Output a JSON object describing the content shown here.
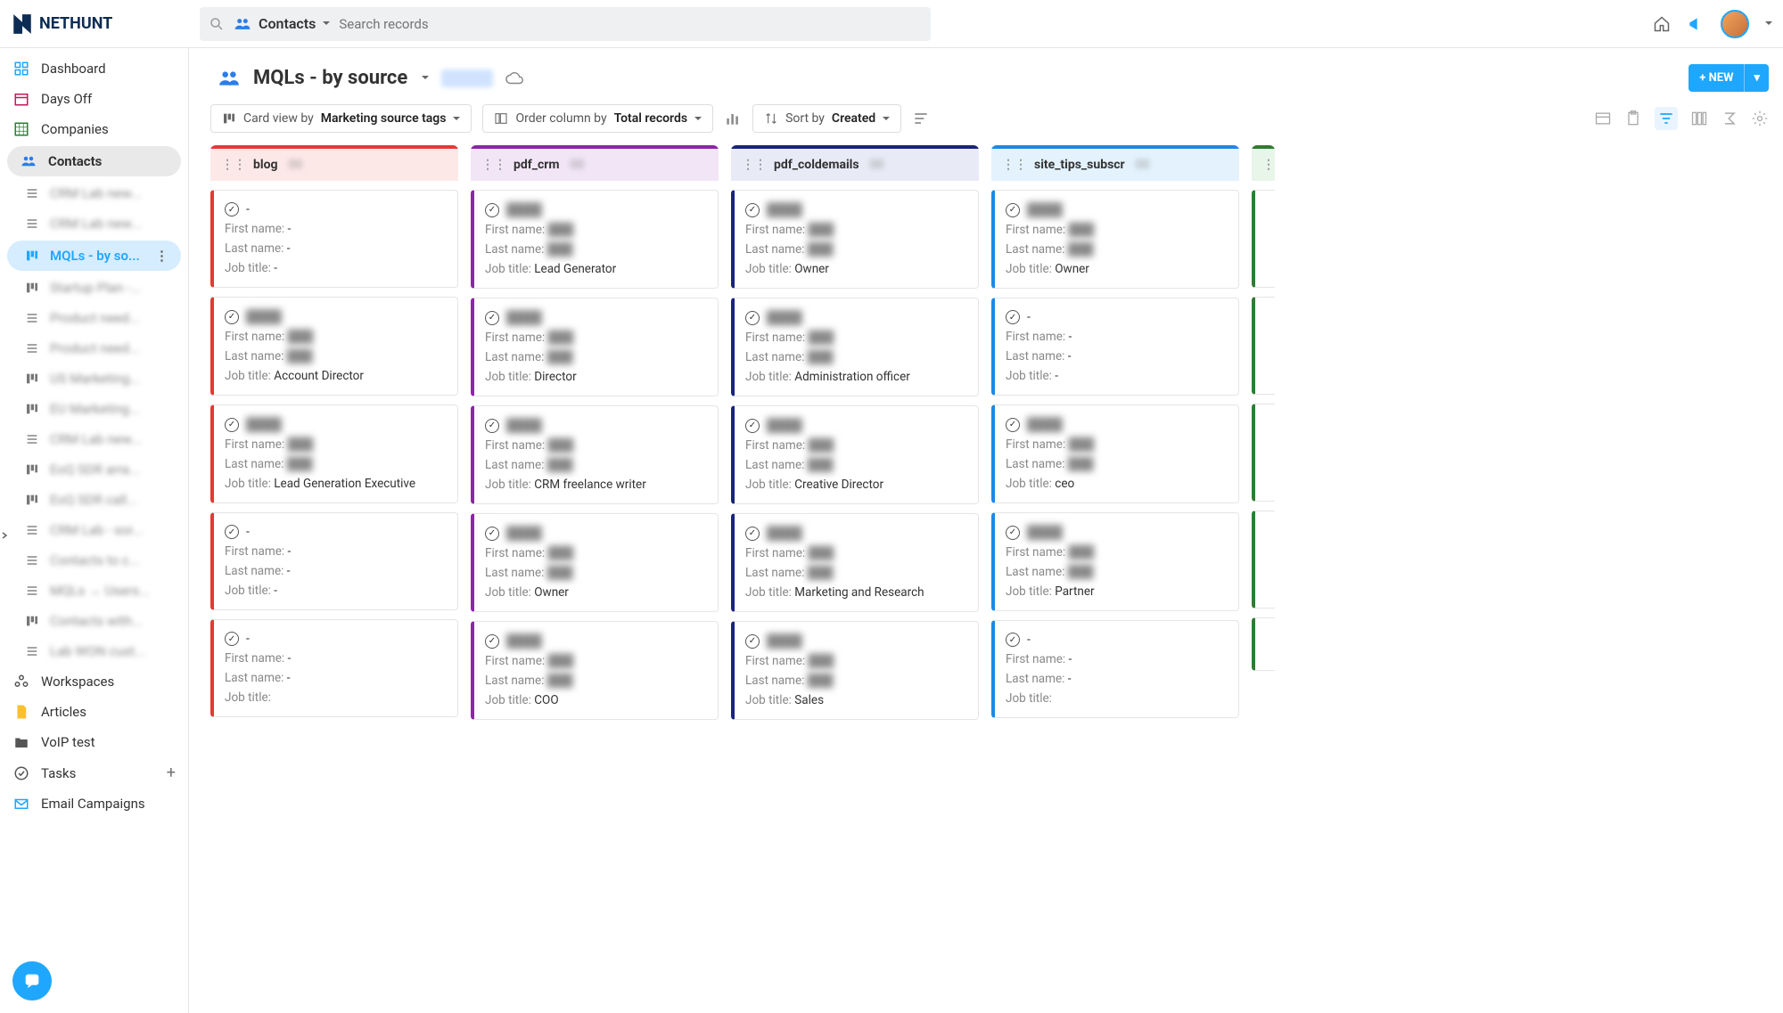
{
  "app": {
    "name": "NETHUNT"
  },
  "search": {
    "entity": "Contacts",
    "placeholder": "Search records"
  },
  "sidebar": {
    "top": [
      {
        "label": "Dashboard",
        "icon": "dashboard"
      },
      {
        "label": "Days Off",
        "icon": "calendar"
      },
      {
        "label": "Companies",
        "icon": "grid"
      }
    ],
    "contacts_label": "Contacts",
    "views_blur": [
      "CRM Lab new...",
      "CRM Lab new..."
    ],
    "active_view": "MQLs - by so...",
    "views_blur2": [
      "Startup Plan -...",
      "Product need...",
      "Product need...",
      "US Marketing...",
      "EU Marketing...",
      "CRM Lab new...",
      "EoQ SDR arra...",
      "EoQ SDR call...",
      "CRM Lab - sor...",
      "Contacts to c...",
      "MQLs → Users...",
      "Contacts with...",
      "Lab WON cust..."
    ],
    "bottom": [
      {
        "label": "Workspaces",
        "icon": "workspaces"
      },
      {
        "label": "Articles",
        "icon": "file"
      },
      {
        "label": "VoIP test",
        "icon": "folder"
      },
      {
        "label": "Tasks",
        "icon": "tasks",
        "plus": true
      },
      {
        "label": "Email Campaigns",
        "icon": "mail"
      }
    ]
  },
  "view": {
    "title": "MQLs - by source",
    "new_btn": "+ NEW",
    "toolbar": {
      "card_prefix": "Card view by",
      "card_value": "Marketing source tags",
      "order_prefix": "Order column by",
      "order_value": "Total records",
      "sort_prefix": "Sort by",
      "sort_value": "Created"
    }
  },
  "field_labels": {
    "first": "First name:",
    "last": "Last name:",
    "job": "Job title:"
  },
  "columns": [
    {
      "name": "blog",
      "color": "red",
      "cards": [
        {
          "title": "-",
          "first": "-",
          "last": "-",
          "job": "-"
        },
        {
          "title_blur": true,
          "first_blur": true,
          "last_blur": true,
          "job": "Account Director"
        },
        {
          "title_blur": true,
          "first_blur": true,
          "last_blur": true,
          "job": "Lead Generation Executive"
        },
        {
          "title": "-",
          "first": "-",
          "last": "-",
          "job": "-"
        },
        {
          "title": "-",
          "first": "-",
          "last": "-",
          "job_partial": true
        }
      ]
    },
    {
      "name": "pdf_crm",
      "color": "purple",
      "cards": [
        {
          "title_blur": true,
          "first_blur": true,
          "last_blur": true,
          "job": "Lead Generator"
        },
        {
          "title_blur": true,
          "first_blur": true,
          "last_blur": true,
          "job": "Director"
        },
        {
          "title_blur": true,
          "first_blur": true,
          "last_blur": true,
          "job": "CRM freelance writer"
        },
        {
          "title_blur": true,
          "first_blur": true,
          "last_blur": true,
          "job": "Owner"
        },
        {
          "title_blur": true,
          "first_blur": true,
          "last_blur": true,
          "job": "COO",
          "job_partial": true
        }
      ]
    },
    {
      "name": "pdf_coldemails",
      "color": "navy",
      "cards": [
        {
          "title_blur": true,
          "first_blur": true,
          "last_blur": true,
          "job": "Owner"
        },
        {
          "title_blur": true,
          "first_blur": true,
          "last_blur": true,
          "job": "Administration officer"
        },
        {
          "title_blur": true,
          "first_blur": true,
          "last_blur": true,
          "job": "Creative Director"
        },
        {
          "title_blur": true,
          "first_blur": true,
          "last_blur": true,
          "job": "Marketing and Research"
        },
        {
          "title_blur": true,
          "first_blur": true,
          "last_blur": true,
          "job": "Sales",
          "job_partial": true
        }
      ]
    },
    {
      "name": "site_tips_subscr",
      "color": "blue",
      "cards": [
        {
          "title_blur": true,
          "first_blur": true,
          "last_blur": true,
          "job": "Owner"
        },
        {
          "title": "-",
          "first": "-",
          "last": "-",
          "job": "-"
        },
        {
          "title_blur": true,
          "first_blur": true,
          "last_blur": true,
          "job": "ceo"
        },
        {
          "title_blur": true,
          "first_blur": true,
          "last_blur": true,
          "job": "Partner"
        },
        {
          "title": "-",
          "first": "-",
          "last": "-",
          "job_partial": true
        }
      ]
    }
  ],
  "partial_column": {
    "color": "green"
  }
}
